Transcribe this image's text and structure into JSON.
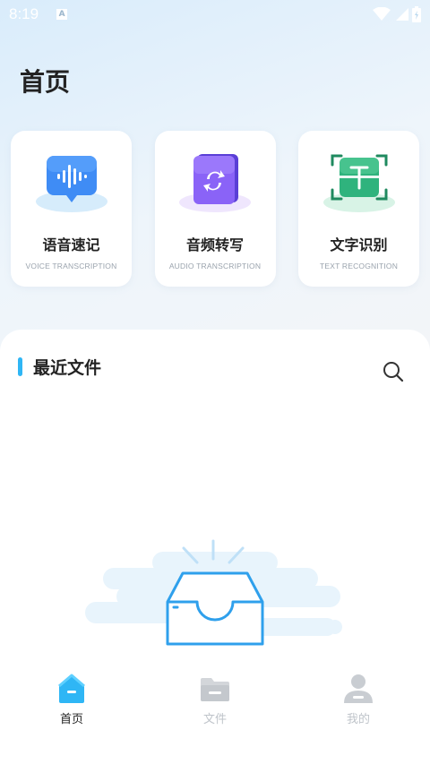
{
  "status_bar": {
    "time": "8:19",
    "notification_letter": "A"
  },
  "page_title": "首页",
  "features": [
    {
      "title": "语音速记",
      "subtitle": "VOICE TRANSCRIPTION",
      "icon": "voice-wave-icon",
      "color": "#3f8cf5"
    },
    {
      "title": "音频转写",
      "subtitle": "AUDIO TRANSCRIPTION",
      "icon": "convert-icon",
      "color": "#7b55f2"
    },
    {
      "title": "文字识别",
      "subtitle": "TEXT RECOGNITION",
      "icon": "text-scan-icon",
      "color": "#2fb37d"
    }
  ],
  "recent": {
    "title": "最近文件",
    "search_icon": "search-icon"
  },
  "nav": [
    {
      "label": "首页",
      "icon": "home-icon",
      "active": true
    },
    {
      "label": "文件",
      "icon": "folder-icon",
      "active": false
    },
    {
      "label": "我的",
      "icon": "profile-icon",
      "active": false
    }
  ],
  "colors": {
    "accent": "#2fb6f5",
    "background": "#f3f5f8"
  }
}
